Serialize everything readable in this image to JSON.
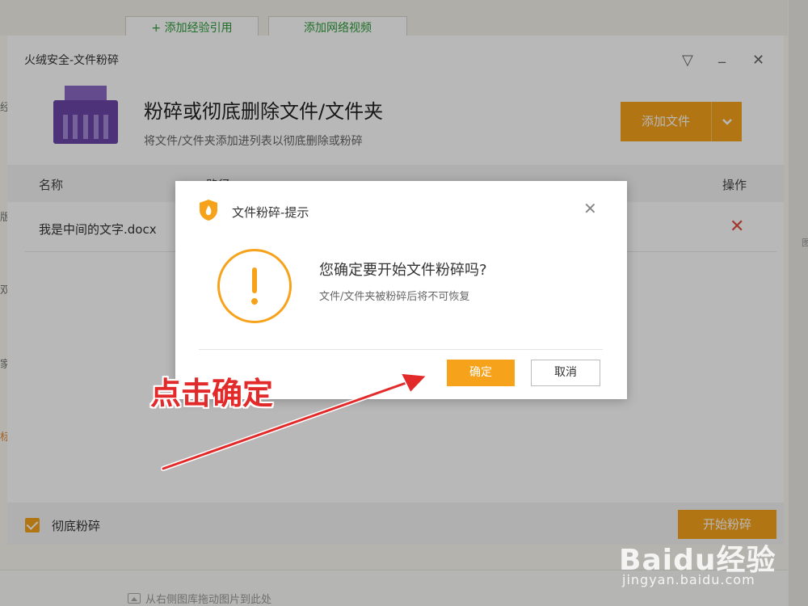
{
  "background": {
    "toolbar_buttons": [
      "+ 添加经验引用",
      "添加网络视频"
    ],
    "left_fragments": [
      "经",
      "版",
      "双",
      "家",
      "标"
    ],
    "right_fragment": "图",
    "drag_hint": "从右侧图库拖动图片到此处"
  },
  "window": {
    "title": "火绒安全-文件粉碎",
    "controls": {
      "menu": "▽",
      "minimize": "_",
      "close": "✕"
    },
    "header_title": "粉碎或彻底删除文件/文件夹",
    "header_subtitle": "将文件/文件夹添加进列表以彻底删除或粉碎",
    "add_button_label": "添加文件",
    "columns": {
      "name": "名称",
      "path": "路径",
      "action": "操作"
    },
    "rows": [
      {
        "name": "我是中间的文字.docx"
      }
    ],
    "footer": {
      "checkbox_label": "彻底粉碎",
      "checkbox_checked": true,
      "start_button_label": "开始粉碎"
    }
  },
  "dialog": {
    "title": "文件粉碎-提示",
    "question": "您确定要开始文件粉碎吗?",
    "note": "文件/文件夹被粉碎后将不可恢复",
    "ok_label": "确定",
    "cancel_label": "取消"
  },
  "annotation": {
    "text": "点击确定"
  },
  "watermark": {
    "main": "Baidu经验",
    "sub": "jingyan.baidu.com"
  },
  "colors": {
    "accent": "#f7a21b",
    "danger": "#e14b3b",
    "annotation": "#e32a2a",
    "shredder": "#6b46a8"
  }
}
